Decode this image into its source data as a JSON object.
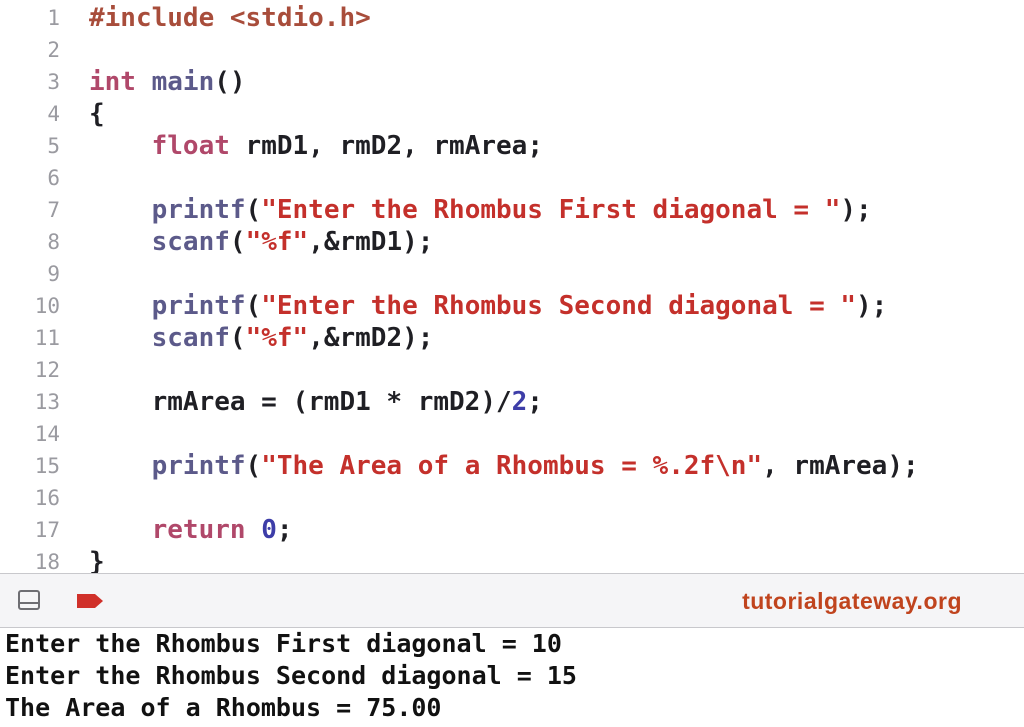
{
  "editor": {
    "line_numbers": [
      "1",
      "2",
      "3",
      "4",
      "5",
      "6",
      "7",
      "8",
      "9",
      "10",
      "11",
      "12",
      "13",
      "14",
      "15",
      "16",
      "17",
      "18"
    ],
    "lines": [
      [
        {
          "t": "pre",
          "v": "#include <stdio.h>"
        }
      ],
      [],
      [
        {
          "t": "kw",
          "v": "int"
        },
        {
          "t": "plain",
          "v": " "
        },
        {
          "t": "fn",
          "v": "main"
        },
        {
          "t": "plain",
          "v": "()"
        }
      ],
      [
        {
          "t": "plain",
          "v": "{"
        }
      ],
      [
        {
          "t": "plain",
          "v": "    "
        },
        {
          "t": "kw",
          "v": "float"
        },
        {
          "t": "plain",
          "v": " rmD1, rmD2, rmArea;"
        }
      ],
      [],
      [
        {
          "t": "plain",
          "v": "    "
        },
        {
          "t": "fn",
          "v": "printf"
        },
        {
          "t": "plain",
          "v": "("
        },
        {
          "t": "str",
          "v": "\"Enter the Rhombus First diagonal = \""
        },
        {
          "t": "plain",
          "v": ");"
        }
      ],
      [
        {
          "t": "plain",
          "v": "    "
        },
        {
          "t": "fn",
          "v": "scanf"
        },
        {
          "t": "plain",
          "v": "("
        },
        {
          "t": "str",
          "v": "\"%f\""
        },
        {
          "t": "plain",
          "v": ",&rmD1);"
        }
      ],
      [],
      [
        {
          "t": "plain",
          "v": "    "
        },
        {
          "t": "fn",
          "v": "printf"
        },
        {
          "t": "plain",
          "v": "("
        },
        {
          "t": "str",
          "v": "\"Enter the Rhombus Second diagonal = \""
        },
        {
          "t": "plain",
          "v": ");"
        }
      ],
      [
        {
          "t": "plain",
          "v": "    "
        },
        {
          "t": "fn",
          "v": "scanf"
        },
        {
          "t": "plain",
          "v": "("
        },
        {
          "t": "str",
          "v": "\"%f\""
        },
        {
          "t": "plain",
          "v": ",&rmD2);"
        }
      ],
      [],
      [
        {
          "t": "plain",
          "v": "    rmArea = (rmD1 * rmD2)/"
        },
        {
          "t": "num",
          "v": "2"
        },
        {
          "t": "plain",
          "v": ";"
        }
      ],
      [],
      [
        {
          "t": "plain",
          "v": "    "
        },
        {
          "t": "fn",
          "v": "printf"
        },
        {
          "t": "plain",
          "v": "("
        },
        {
          "t": "str",
          "v": "\"The Area of a Rhombus = %.2f\\n\""
        },
        {
          "t": "plain",
          "v": ", rmArea);"
        }
      ],
      [],
      [
        {
          "t": "plain",
          "v": "    "
        },
        {
          "t": "kw",
          "v": "return"
        },
        {
          "t": "plain",
          "v": " "
        },
        {
          "t": "num",
          "v": "0"
        },
        {
          "t": "plain",
          "v": ";"
        }
      ],
      [
        {
          "t": "plain",
          "v": "}"
        }
      ]
    ]
  },
  "toolbar": {
    "panel_icon": "panel-toggle-icon",
    "output_icon": "output-tag-icon",
    "output_icon_color": "#d0302a",
    "brand_text": "tutorialgateway.org",
    "brand_color": "#c0441e"
  },
  "console": {
    "lines": [
      "Enter the Rhombus First diagonal = 10",
      "Enter the Rhombus Second diagonal = 15",
      "The Area of a Rhombus = 75.00"
    ]
  }
}
